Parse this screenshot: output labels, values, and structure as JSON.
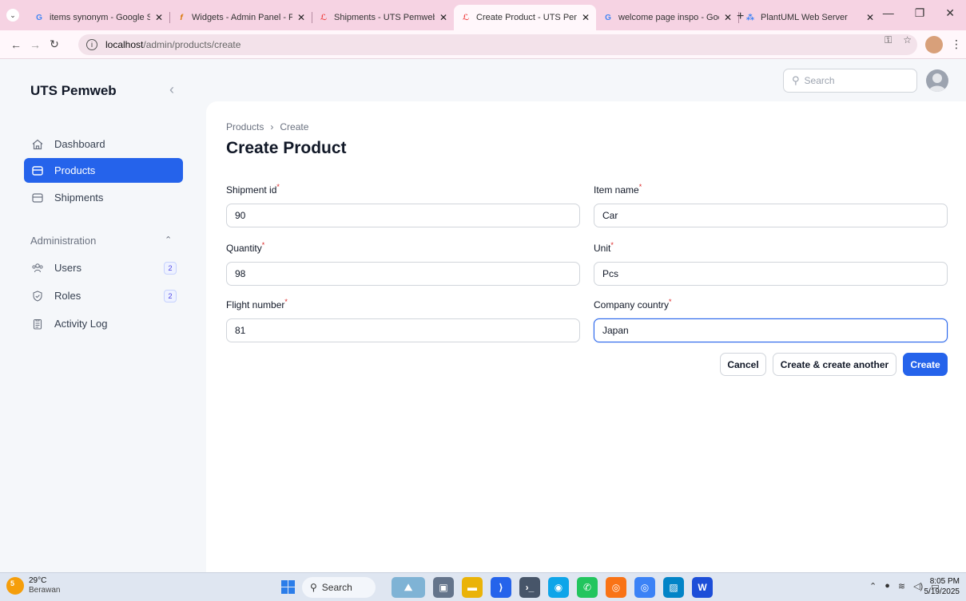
{
  "browser": {
    "tabs": [
      {
        "title": "items synonym - Google S",
        "icon": "google-icon",
        "color": "#4285f4",
        "glyph": "G",
        "active": false
      },
      {
        "title": "Widgets - Admin Panel - F",
        "icon": "filament-icon",
        "color": "#f59e0b",
        "glyph": "f",
        "active": false
      },
      {
        "title": "Shipments - UTS Pemweb",
        "icon": "laravel-icon",
        "color": "#ef4444",
        "glyph": "L",
        "active": false
      },
      {
        "title": "Create Product - UTS Pem",
        "icon": "laravel-icon",
        "color": "#ef4444",
        "glyph": "L",
        "active": true
      },
      {
        "title": "welcome page inspo - Goo",
        "icon": "google-icon",
        "color": "#4285f4",
        "glyph": "G",
        "active": false
      },
      {
        "title": "PlantUML Web Server",
        "icon": "plantuml-icon",
        "color": "#3b82f6",
        "glyph": "•",
        "active": false
      }
    ],
    "url_host": "localhost",
    "url_path": "/admin/products/create"
  },
  "app": {
    "brand": "UTS Pemweb",
    "search_placeholder": "Search"
  },
  "sidebar": {
    "items": [
      {
        "label": "Dashboard",
        "icon": "home-icon",
        "active": false
      },
      {
        "label": "Products",
        "icon": "box-icon",
        "active": true
      },
      {
        "label": "Shipments",
        "icon": "box-icon",
        "active": false
      }
    ],
    "group_label": "Administration",
    "admin_items": [
      {
        "label": "Users",
        "icon": "users-icon",
        "badge": "2"
      },
      {
        "label": "Roles",
        "icon": "shield-check-icon",
        "badge": "2"
      },
      {
        "label": "Activity Log",
        "icon": "clipboard-icon",
        "badge": ""
      }
    ]
  },
  "page": {
    "breadcrumb": [
      "Products",
      "Create"
    ],
    "title": "Create Product"
  },
  "form": {
    "fields": [
      {
        "label": "Shipment id",
        "value": "90"
      },
      {
        "label": "Item name",
        "value": "Car"
      },
      {
        "label": "Quantity",
        "value": "98"
      },
      {
        "label": "Unit",
        "value": "Pcs"
      },
      {
        "label": "Flight number",
        "value": "81"
      },
      {
        "label": "Company country",
        "value": "Japan"
      }
    ],
    "required_mark": "*",
    "buttons": {
      "cancel": "Cancel",
      "create_another": "Create & create another",
      "create": "Create"
    }
  },
  "taskbar": {
    "temperature": "29°C",
    "weather": "Berawan",
    "weather_badge": "5",
    "search": "Search",
    "time": "8:05 PM",
    "date": "5/19/2025"
  },
  "colors": {
    "primary": "#2563eb",
    "tabstrip": "#f6d3e3"
  }
}
